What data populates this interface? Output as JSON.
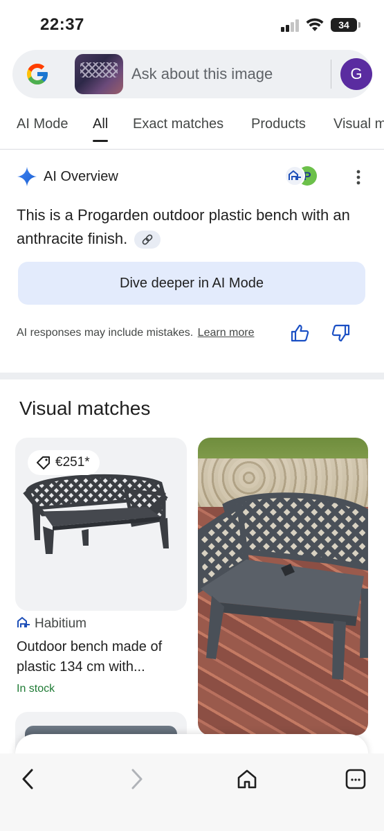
{
  "status_bar": {
    "time": "22:37",
    "battery": "34"
  },
  "search": {
    "placeholder": "Ask about this image",
    "avatar_letter": "G"
  },
  "tabs": [
    {
      "label": "AI Mode",
      "active": false
    },
    {
      "label": "All",
      "active": true
    },
    {
      "label": "Exact matches",
      "active": false
    },
    {
      "label": "Products",
      "active": false
    },
    {
      "label": "Visual m",
      "active": false
    }
  ],
  "ai_overview": {
    "title": "AI Overview",
    "text": "This is a Progarden outdoor plastic bench with an anthracite finish.",
    "dive_button": "Dive deeper in AI Mode",
    "disclaimer": "AI responses may include mistakes.",
    "learn_more": "Learn more"
  },
  "visual_matches": {
    "title": "Visual matches",
    "items": [
      {
        "price": "€251*",
        "source": "Habitium",
        "title": "Outdoor bench made of plastic 134 cm with...",
        "stock": "In stock"
      }
    ]
  },
  "colors": {
    "accent": "#1a73e8",
    "dive_bg": "#e3ebfc",
    "stock_green": "#1e7a34",
    "avatar_bg": "#5a2ca0"
  },
  "icons": [
    "google-logo-icon",
    "sparkle-icon",
    "more-vert-icon",
    "link-icon",
    "thumb-up-icon",
    "thumb-down-icon",
    "price-tag-icon",
    "habitium-icon",
    "back-icon",
    "forward-icon",
    "home-icon",
    "tabs-icon"
  ]
}
